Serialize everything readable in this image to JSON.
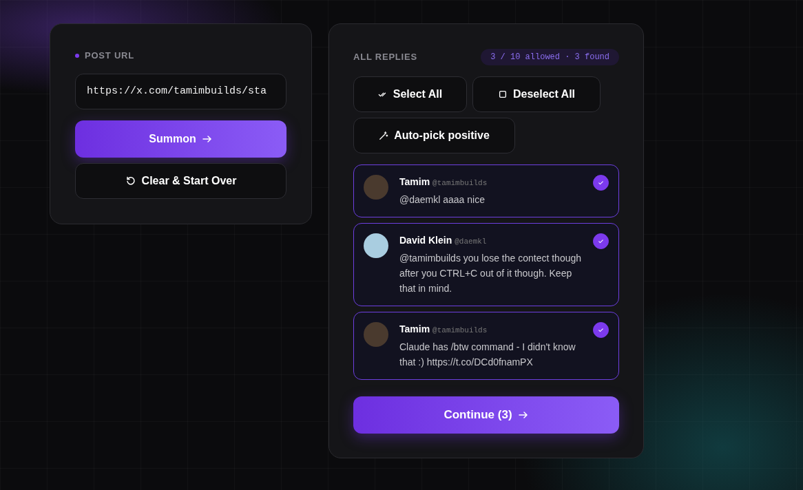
{
  "url_panel": {
    "label": "POST URL",
    "url_value": "https://x.com/tamimbuilds/sta",
    "summon_button": "Summon",
    "clear_button": "Clear & Start Over"
  },
  "replies_panel": {
    "title": "ALL REPLIES",
    "counter": "3 / 10 allowed · 3 found",
    "actions": [
      "Select All",
      "Deselect All",
      "Auto-pick positive"
    ],
    "replies": [
      {
        "name": "Tamim",
        "handle": "@tamimbuilds",
        "text": "@daemkl aaaa nice",
        "selected": true
      },
      {
        "name": "David Klein",
        "handle": "@daemkl",
        "text": "@tamimbuilds you lose the contect though after you CTRL+C out of it though. Keep that in mind.",
        "selected": true
      },
      {
        "name": "Tamim",
        "handle": "@tamimbuilds",
        "text": "Claude has /btw command - I didn't know that :) https://t.co/DCd0fnamPX",
        "selected": true
      }
    ],
    "continue_button": "Continue (3)"
  }
}
